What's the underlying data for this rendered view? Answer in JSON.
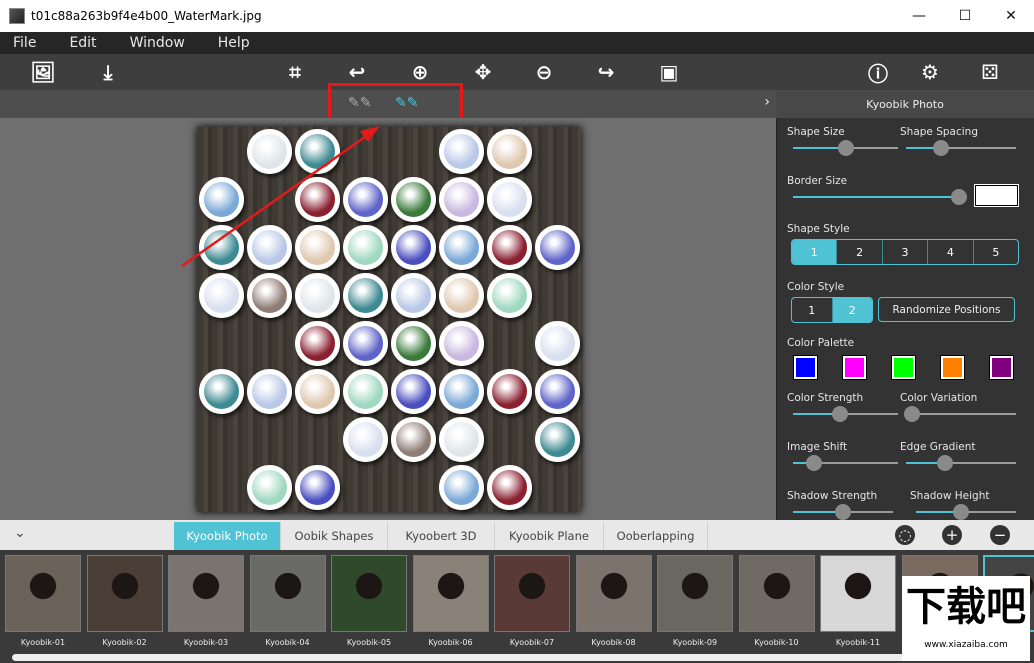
{
  "window": {
    "title": "t01c88a263b9f4e4b00_WaterMark.jpg",
    "minimize": "—",
    "maximize": "☐",
    "close": "✕"
  },
  "menu": [
    "File",
    "Edit",
    "Window",
    "Help"
  ],
  "toolbar": {
    "icons": [
      "open-image",
      "save",
      "crop",
      "undo",
      "zoom-in",
      "move",
      "zoom-out",
      "redo",
      "fit-image",
      "info",
      "settings",
      "random-dice"
    ]
  },
  "panel": {
    "title": "Kyoobik Photo",
    "shape_size": {
      "label": "Shape Size",
      "value": 0.5
    },
    "shape_spacing": {
      "label": "Shape Spacing",
      "value": 0.32
    },
    "border_size": {
      "label": "Border Size",
      "value": 1.0,
      "color": "#ffffff"
    },
    "shape_style": {
      "label": "Shape Style",
      "options": [
        "1",
        "2",
        "3",
        "4",
        "5"
      ],
      "selected": "1"
    },
    "color_style": {
      "label": "Color Style",
      "options": [
        "1",
        "2"
      ],
      "selected": "2"
    },
    "randomize": "Randomize Positions",
    "color_palette": {
      "label": "Color Palette",
      "colors": [
        "#0000ff",
        "#ff00ff",
        "#00ff00",
        "#ff8000",
        "#800080"
      ]
    },
    "color_strength": {
      "label": "Color Strength",
      "value": 0.45
    },
    "color_variation": {
      "label": "Color Variation",
      "value": 0.05
    },
    "image_shift": {
      "label": "Image Shift",
      "value": 0.2
    },
    "edge_gradient": {
      "label": "Edge Gradient",
      "value": 0.35
    },
    "shadow_strength": {
      "label": "Shadow Strength",
      "value": 0.5
    },
    "shadow_height": {
      "label": "Shadow Height",
      "value": 0.45
    }
  },
  "tabs": [
    "Kyoobik Photo",
    "Oobik Shapes",
    "Kyoobert 3D",
    "Kyoobik Plane",
    "Ooberlapping"
  ],
  "active_tab": "Kyoobik Photo",
  "presets": [
    "Kyoobik-01",
    "Kyoobik-02",
    "Kyoobik-03",
    "Kyoobik-04",
    "Kyoobik-05",
    "Kyoobik-06",
    "Kyoobik-07",
    "Kyoobik-08",
    "Kyoobik-09",
    "Kyoobik-10",
    "Kyoobik-11"
  ],
  "watermark": {
    "text": "下载吧",
    "url": "www.xiazaiba.com"
  },
  "accent": "#4fc3d4"
}
